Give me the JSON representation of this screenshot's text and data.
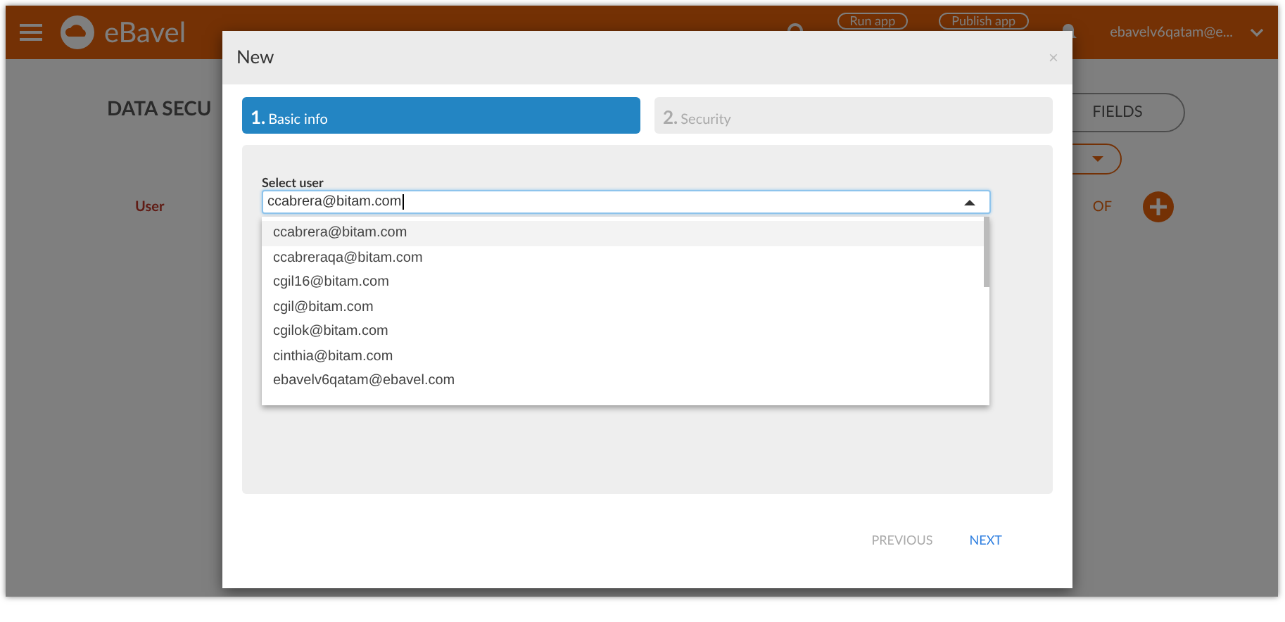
{
  "app_bar": {
    "logo": "eBavel",
    "buttons": [
      "Run app",
      "Publish app"
    ],
    "user": "ebavelv6qatam@e..."
  },
  "page": {
    "title": "DATA SECU",
    "fields_button": "FIELDS",
    "column_header": "User",
    "partial_header": "OF"
  },
  "dialog": {
    "title": "New",
    "close": "×",
    "steps": [
      {
        "number": "1.",
        "label": "Basic info",
        "selected": true
      },
      {
        "number": "2.",
        "label": "Security",
        "selected": false
      }
    ],
    "select_user": {
      "label": "Select user",
      "value": "ccabrera@bitam.com",
      "expanded": true,
      "options": [
        {
          "text": "ccabrera@bitam.com",
          "selected": true
        },
        {
          "text": "ccabreraqa@bitam.com",
          "selected": false
        },
        {
          "text": "cgil16@bitam.com",
          "selected": false
        },
        {
          "text": "cgil@bitam.com",
          "selected": false
        },
        {
          "text": "cgilok@bitam.com",
          "selected": false
        },
        {
          "text": "cinthia@bitam.com",
          "selected": false
        },
        {
          "text": "ebavelv6qatam@ebavel.com",
          "selected": false
        }
      ]
    },
    "footer": [
      {
        "label": "PREVIOUS",
        "disabled": true
      },
      {
        "label": "NEXT",
        "disabled": false
      }
    ]
  }
}
